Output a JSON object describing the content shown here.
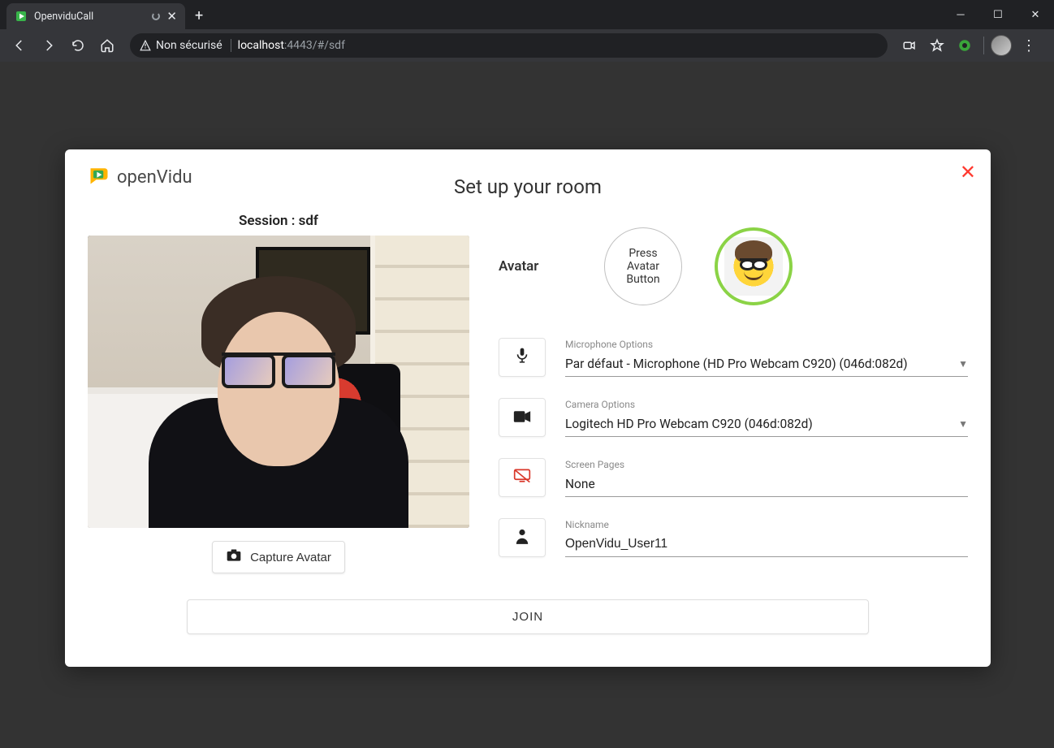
{
  "browser": {
    "tab_title": "OpenviduCall",
    "security_label": "Non sécurisé",
    "url_host": "localhost",
    "url_rest": ":4443/#/sdf"
  },
  "dialog": {
    "brand": "openVidu",
    "title": "Set up your room",
    "session_label": "Session : sdf",
    "capture_button": "Capture Avatar",
    "avatar_label": "Avatar",
    "avatar_empty_text": "Press Avatar Button",
    "join_button": "JOIN"
  },
  "form": {
    "mic": {
      "label": "Microphone Options",
      "value": "Par défaut - Microphone (HD Pro Webcam C920) (046d:082d)"
    },
    "camera": {
      "label": "Camera Options",
      "value": "Logitech HD Pro Webcam C920 (046d:082d)"
    },
    "screen": {
      "label": "Screen Pages",
      "value": "None"
    },
    "nickname": {
      "label": "Nickname",
      "value": "OpenVidu_User11"
    }
  }
}
